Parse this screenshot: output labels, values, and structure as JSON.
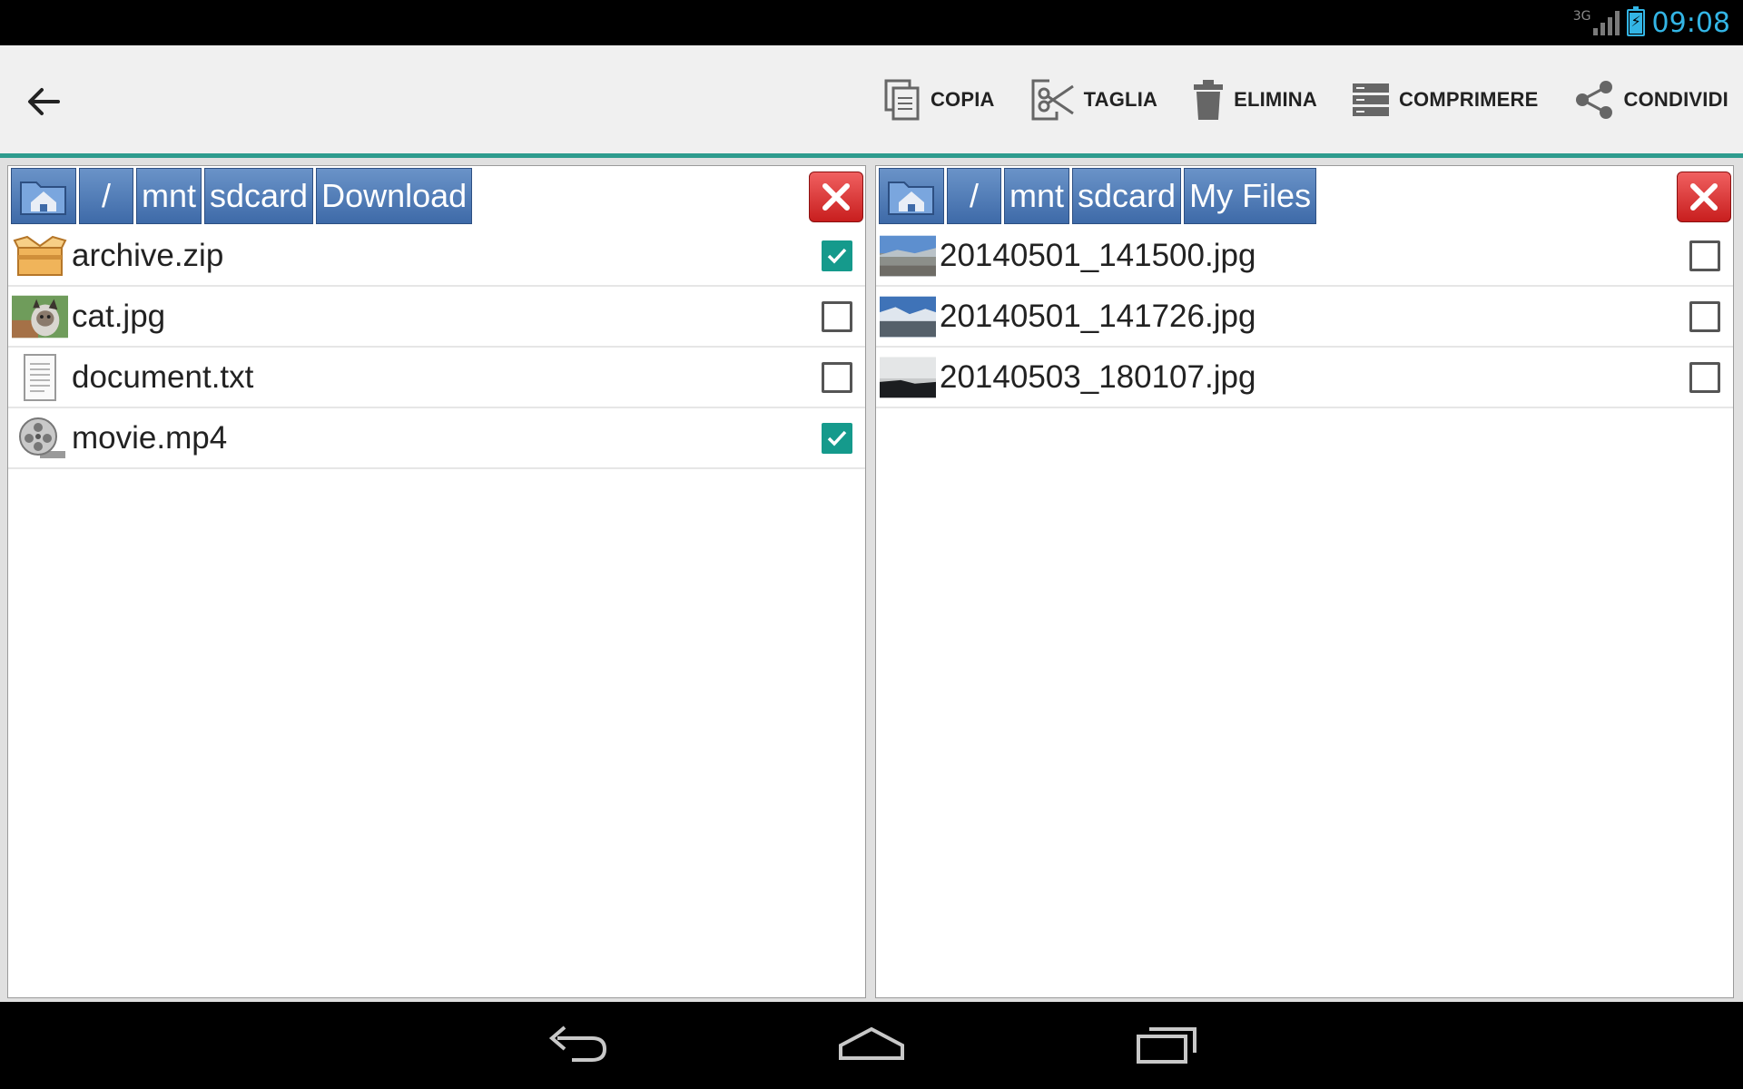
{
  "status_bar": {
    "network_type": "3G",
    "time": "09:08"
  },
  "action_bar": {
    "back_icon": "arrow-left-icon",
    "actions": [
      {
        "label": "COPIA",
        "icon": "copy-icon"
      },
      {
        "label": "TAGLIA",
        "icon": "cut-icon"
      },
      {
        "label": "ELIMINA",
        "icon": "trash-icon"
      },
      {
        "label": "COMPRIMERE",
        "icon": "compress-icon"
      },
      {
        "label": "CONDIVIDI",
        "icon": "share-icon"
      }
    ]
  },
  "left_pane": {
    "breadcrumb": [
      "/",
      "mnt",
      "sdcard",
      "Download"
    ],
    "files": [
      {
        "name": "archive.zip",
        "icon": "archive-icon",
        "checked": true
      },
      {
        "name": "cat.jpg",
        "icon": "image-thumbnail",
        "checked": false
      },
      {
        "name": "document.txt",
        "icon": "text-file-icon",
        "checked": false
      },
      {
        "name": "movie.mp4",
        "icon": "film-reel-icon",
        "checked": true
      }
    ]
  },
  "right_pane": {
    "breadcrumb": [
      "/",
      "mnt",
      "sdcard",
      "My Files"
    ],
    "files": [
      {
        "name": "20140501_141500.jpg",
        "icon": "image-thumbnail",
        "checked": false
      },
      {
        "name": "20140501_141726.jpg",
        "icon": "image-thumbnail",
        "checked": false
      },
      {
        "name": "20140503_180107.jpg",
        "icon": "image-thumbnail",
        "checked": false
      }
    ]
  },
  "colors": {
    "accent": "#2e9c8e",
    "checkbox_on": "#159a8c",
    "clock": "#33b5e5",
    "crumb": "#3e6aa8",
    "close": "#d42a2a"
  }
}
